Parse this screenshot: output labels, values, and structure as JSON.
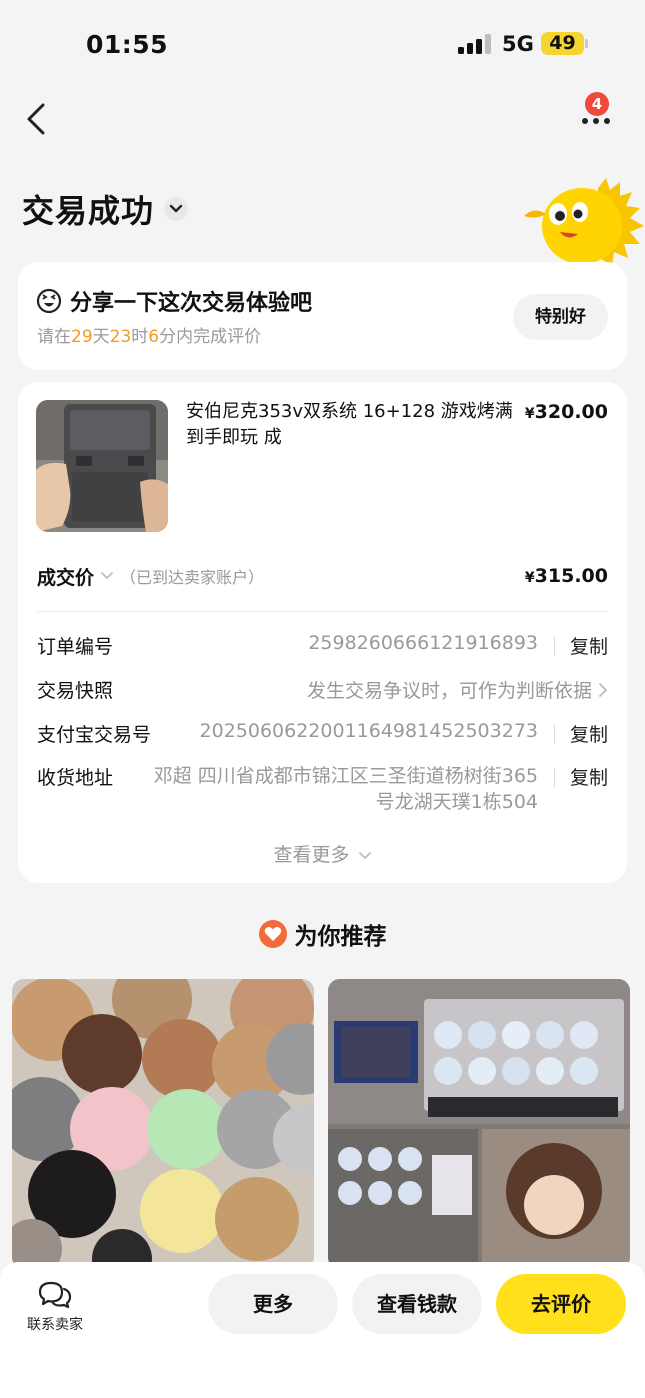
{
  "status_bar": {
    "time": "01:55",
    "network": "5G",
    "battery": "49"
  },
  "nav": {
    "notification_count": "4"
  },
  "page": {
    "title": "交易成功"
  },
  "review_card": {
    "title": "分享一下这次交易体验吧",
    "sub_prefix": "请在",
    "days": "29",
    "days_unit": "天",
    "hours": "23",
    "hours_unit": "时",
    "minutes": "6",
    "minutes_suffix": "分内完成评价",
    "button": "特别好"
  },
  "order": {
    "item_title": "安伯尼克353v双系统 16+128 游戏烤满 到手即玩 成",
    "item_price_symbol": "¥",
    "item_price": "320.00",
    "deal_label": "成交价",
    "deal_note": "（已到达卖家账户）",
    "deal_price_symbol": "¥",
    "deal_price": "315.00",
    "rows": [
      {
        "label": "订单编号",
        "value": "2598260666121916893",
        "action": "复制"
      },
      {
        "label": "交易快照",
        "value": "发生交易争议时，可作为判断依据"
      },
      {
        "label": "支付宝交易号",
        "value": "2025060622001164981452503273",
        "action": "复制"
      },
      {
        "label": "收货地址",
        "value": "邓超 四川省成都市锦江区三圣街道杨树街365号龙湖天璞1栋504",
        "action": "复制"
      }
    ],
    "see_more": "查看更多"
  },
  "recommend": {
    "title": "为你推荐"
  },
  "bottom_bar": {
    "contact_label": "联系卖家",
    "more_label": "更多",
    "money_label": "查看钱款",
    "review_label": "去评价"
  },
  "colors": {
    "accent_yellow": "#ffe01b",
    "highlight_orange": "#f59a23",
    "badge_red": "#f04a3c",
    "heart_orange": "#f26b3a"
  }
}
